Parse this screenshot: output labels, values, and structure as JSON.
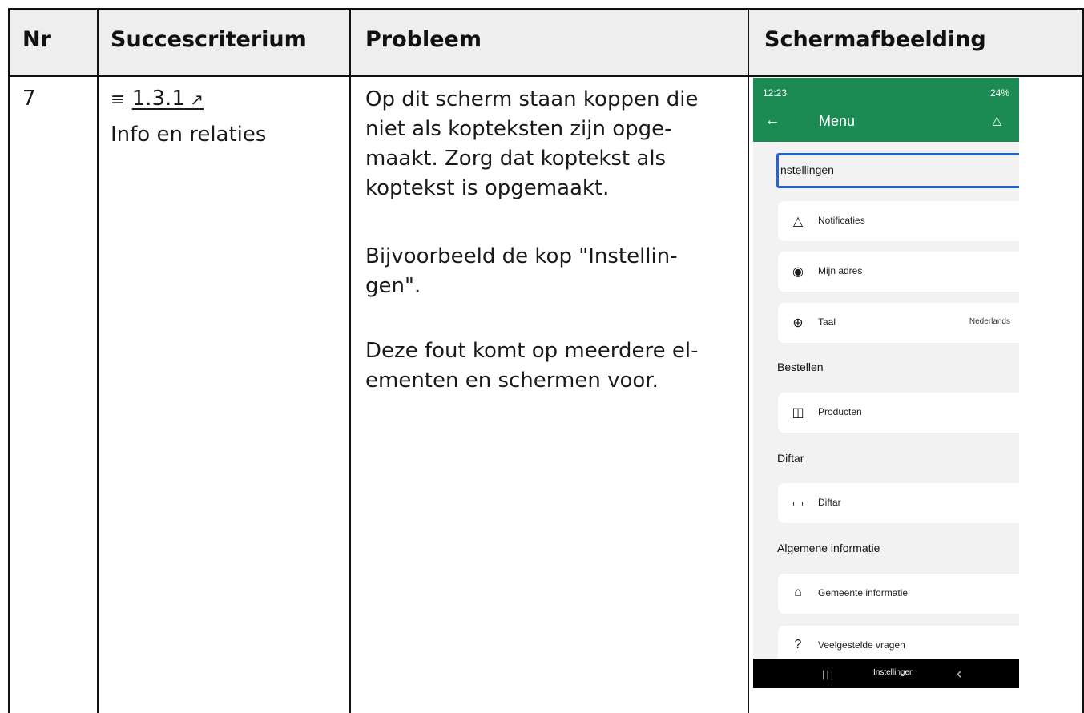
{
  "table": {
    "headers": [
      "Nr",
      "Succescriterium",
      "Probleem",
      "Schermafbeelding"
    ],
    "row": {
      "nr": "7",
      "criterion_number": "1.3.1",
      "criterion_name": "Info en relaties",
      "problem_paragraphs": [
        [
          "Op dit scherm staan koppen die",
          "niet als kopteksten zijn opge-",
          "maakt. Zorg dat koptekst als",
          "koptekst is opgemaakt."
        ],
        [
          "Bijvoorbeeld de kop \"Instellin-",
          "gen\"."
        ],
        [
          "Deze fout komt op meerdere el-",
          "ementen en schermen voor."
        ]
      ]
    }
  },
  "screenshot": {
    "status_time": "12:23",
    "status_battery": "24%",
    "title": "Menu",
    "focused_heading": "nstellingen",
    "items": [
      {
        "icon": "bell-icon",
        "label": "Notificaties"
      },
      {
        "icon": "user-circle-icon",
        "label": "Mijn adres"
      },
      {
        "icon": "globe-icon",
        "label": "Taal",
        "value": "Nederlands"
      }
    ],
    "sections": [
      "Bestellen",
      "Diftar",
      "Algemene informatie"
    ],
    "bestellen_item": {
      "icon": "shopping-bag-icon",
      "label": "Producten"
    },
    "diftar_item": {
      "icon": "trash-icon",
      "label": "Diftar"
    },
    "info_items": [
      {
        "icon": "building-icon",
        "label": "Gemeente informatie"
      },
      {
        "icon": "question-icon",
        "label": "Veelgestelde vragen"
      }
    ],
    "nav_label": "Instellingen",
    "accent_color": "#1b8a53",
    "focus_color": "#2563d9"
  }
}
